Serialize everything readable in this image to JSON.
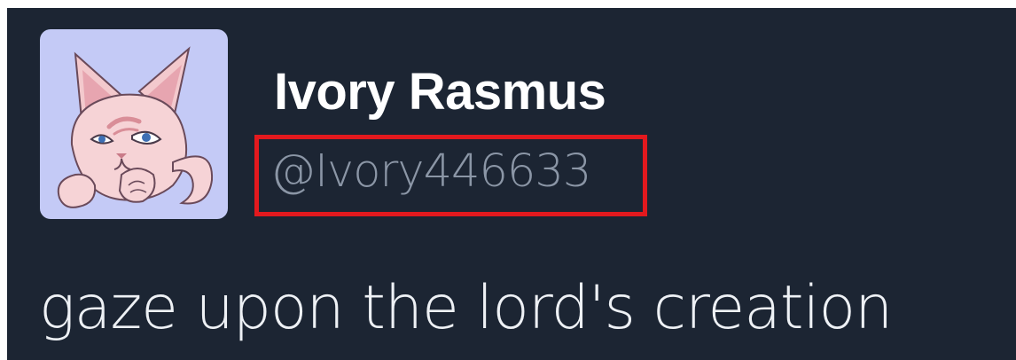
{
  "tweet": {
    "display_name": "Ivory Rasmus",
    "handle": "@Ivory446633",
    "text": "gaze upon the lord's creation"
  },
  "colors": {
    "background": "#1c2533",
    "avatar_background": "#c4caf6",
    "highlight_border": "#e3191e",
    "handle_text": "#8b96a6",
    "name_text": "#ffffff"
  },
  "icons": {
    "avatar": "pink-cat-character-avatar"
  }
}
